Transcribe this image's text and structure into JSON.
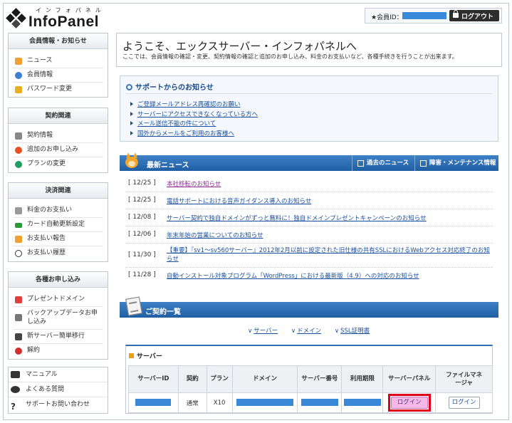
{
  "header": {
    "logo_kana": "インフォパネル",
    "logo_text": "InfoPanel",
    "member_label": "★会員ID：",
    "logout_label": "ログアウト"
  },
  "sidebar": {
    "groups": [
      {
        "title": "会員情報・お知らせ",
        "items": [
          "ニュース",
          "会員情報",
          "パスワード変更"
        ]
      },
      {
        "title": "契約関連",
        "items": [
          "契約情報",
          "追加のお申し込み",
          "プランの変更"
        ]
      },
      {
        "title": "決済関連",
        "items": [
          "料金のお支払い",
          "カード自動更新設定",
          "お支払い報告",
          "お支払い履歴"
        ]
      },
      {
        "title": "各種お申し込み",
        "items": [
          "プレゼントドメイン",
          "バックアップデータお申し込み",
          "新サーバー簡単移行",
          "解約"
        ]
      }
    ],
    "bottom": [
      "マニュアル",
      "よくある質問",
      "サポートお問い合わせ"
    ]
  },
  "welcome": {
    "title": "ようこそ、エックスサーバー・インフォパネルへ",
    "subtitle": "ここでは、会員情報の確認・変更、契約情報の確認と追加のお申し込み、料金のお支払いなど、各種手続きを行うことが出来ます。"
  },
  "support": {
    "title": "サポートからのお知らせ",
    "links": [
      "ご登録メールアドレス再確認のお願い",
      "サーバーにアクセスできなくなっている方へ",
      "メール送信不能の件について",
      "国外からメールをご利用のお客様へ"
    ]
  },
  "news": {
    "title": "最新ニュース",
    "past_label": "過去のニュース",
    "maint_label": "障害・メンテナンス情報",
    "items": [
      {
        "date": "[ 12/25 ]",
        "text": "本社移転のお知らせ"
      },
      {
        "date": "[ 12/25 ]",
        "text": "電話サポートにおける音声ガイダンス導入のお知らせ"
      },
      {
        "date": "[ 12/08 ]",
        "text": "サーバー契約で独自ドメインがずっと無料に！独自ドメインプレゼントキャンペーンのお知らせ"
      },
      {
        "date": "[ 12/06 ]",
        "text": "年末年始の営業についてのお知らせ"
      },
      {
        "date": "[ 11/30 ]",
        "text": "【重要】『sv1～sv560サーバー』2012年2月以前に設定された旧仕様の共有SSLにおけるWebアクセス対応終了のお知らせ"
      },
      {
        "date": "[ 11/28 ]",
        "text": "自動インストール対象プログラム「WordPress」における最新版（4.9）への対応のお知らせ"
      }
    ]
  },
  "contracts": {
    "title": "ご契約一覧",
    "anchors": [
      "サーバー",
      "ドメイン",
      "SSL証明書"
    ],
    "server_title": "サーバー",
    "columns": [
      "サーバーID",
      "契約",
      "プラン",
      "ドメイン",
      "サーバー番号",
      "利用期限",
      "サーバーパネル",
      "ファイルマネージャ"
    ],
    "row": {
      "contract": "通常",
      "plan": "X10",
      "panel_btn": "ログイン",
      "fm_btn": "ログイン"
    }
  },
  "colors": {
    "accent_blue": "#2f6db0",
    "highlight": "#e0001b",
    "mask_blue": "#3a88d8"
  }
}
